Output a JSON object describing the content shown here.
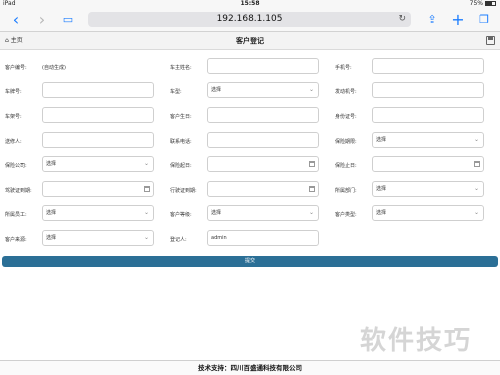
{
  "status": {
    "device": "iPad",
    "time": "15:58",
    "battery": "75%"
  },
  "browser": {
    "url": "192.168.1.105"
  },
  "header": {
    "home_label": "主页",
    "title": "客户登记"
  },
  "rows": [
    [
      {
        "label": "客户编号:",
        "type": "static",
        "value": "(自动生成)"
      },
      {
        "label": "车主姓名:",
        "type": "text",
        "value": ""
      },
      {
        "label": "手机号:",
        "type": "text",
        "value": ""
      }
    ],
    [
      {
        "label": "车牌号:",
        "type": "text",
        "value": ""
      },
      {
        "label": "车型:",
        "type": "select",
        "value": "选择"
      },
      {
        "label": "发动机号:",
        "type": "text",
        "value": ""
      }
    ],
    [
      {
        "label": "车架号:",
        "type": "text",
        "value": ""
      },
      {
        "label": "客户生日:",
        "type": "text",
        "value": ""
      },
      {
        "label": "身份证号:",
        "type": "text",
        "value": ""
      }
    ],
    [
      {
        "label": "送修人:",
        "type": "text",
        "value": ""
      },
      {
        "label": "联系电话:",
        "type": "text",
        "value": ""
      },
      {
        "label": "保险期限:",
        "type": "select",
        "value": "选择"
      }
    ],
    [
      {
        "label": "保险公司:",
        "type": "select",
        "value": "选择"
      },
      {
        "label": "保险起日:",
        "type": "date",
        "value": ""
      },
      {
        "label": "保险止日:",
        "type": "date",
        "value": ""
      }
    ],
    [
      {
        "label": "驾驶证到期:",
        "type": "date",
        "value": ""
      },
      {
        "label": "行驶证到期:",
        "type": "date",
        "value": ""
      },
      {
        "label": "所属部门:",
        "type": "select",
        "value": "选择"
      }
    ],
    [
      {
        "label": "所属员工:",
        "type": "select",
        "value": "选择"
      },
      {
        "label": "客户等级:",
        "type": "select",
        "value": "选择"
      },
      {
        "label": "客户类型:",
        "type": "select",
        "value": "选择"
      }
    ],
    [
      {
        "label": "客户来源:",
        "type": "select",
        "value": "选择"
      },
      {
        "label": "登记人:",
        "type": "text",
        "value": "admin"
      }
    ]
  ],
  "submit_label": "提交",
  "watermark": "软件技巧",
  "footer": "技术支持：四川百盛通科技有限公司"
}
